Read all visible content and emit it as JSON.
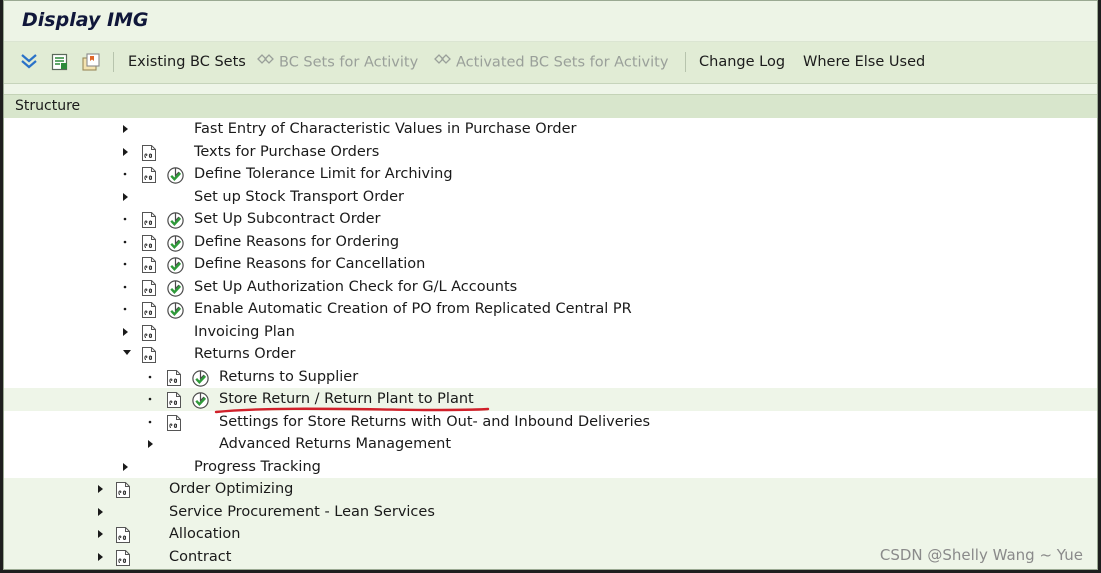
{
  "window_title": "Display IMG",
  "toolbar": {
    "existing_bc_sets": "Existing BC Sets",
    "bc_sets_for_activity": "BC Sets for Activity",
    "activated_bc_sets_for_activity": "Activated BC Sets for Activity",
    "change_log": "Change Log",
    "where_else_used": "Where Else Used"
  },
  "structure_header": "Structure",
  "tree": [
    {
      "label": "Fast Entry of Characteristic Values in Purchase Order",
      "level": 2,
      "expander": "collapsed",
      "doc": false,
      "activity": false,
      "band": "white"
    },
    {
      "label": "Texts for Purchase Orders",
      "level": 2,
      "expander": "collapsed",
      "doc": true,
      "activity": false,
      "band": "white"
    },
    {
      "label": "Define Tolerance Limit for Archiving",
      "level": 2,
      "expander": "leaf",
      "doc": true,
      "activity": true,
      "band": "white"
    },
    {
      "label": "Set up Stock Transport Order",
      "level": 2,
      "expander": "collapsed",
      "doc": false,
      "activity": false,
      "band": "white"
    },
    {
      "label": "Set Up Subcontract Order",
      "level": 2,
      "expander": "leaf",
      "doc": true,
      "activity": true,
      "band": "white"
    },
    {
      "label": "Define Reasons for Ordering",
      "level": 2,
      "expander": "leaf",
      "doc": true,
      "activity": true,
      "band": "white"
    },
    {
      "label": "Define Reasons for Cancellation",
      "level": 2,
      "expander": "leaf",
      "doc": true,
      "activity": true,
      "band": "white"
    },
    {
      "label": "Set Up Authorization Check for G/L Accounts",
      "level": 2,
      "expander": "leaf",
      "doc": true,
      "activity": true,
      "band": "white"
    },
    {
      "label": "Enable Automatic Creation of PO from Replicated Central PR",
      "level": 2,
      "expander": "leaf",
      "doc": true,
      "activity": true,
      "band": "white"
    },
    {
      "label": "Invoicing Plan",
      "level": 2,
      "expander": "collapsed",
      "doc": true,
      "activity": false,
      "band": "white"
    },
    {
      "label": "Returns Order",
      "level": 2,
      "expander": "expanded",
      "doc": true,
      "activity": false,
      "band": "white"
    },
    {
      "label": "Returns to Supplier",
      "level": 3,
      "expander": "leaf",
      "doc": true,
      "activity": true,
      "band": "white"
    },
    {
      "label": "Store Return / Return Plant to Plant",
      "level": 3,
      "expander": "leaf",
      "doc": true,
      "activity": true,
      "band": "selected"
    },
    {
      "label": "Settings for Store Returns with Out- and Inbound Deliveries",
      "level": 3,
      "expander": "leaf",
      "doc": true,
      "activity": false,
      "band": "white"
    },
    {
      "label": "Advanced Returns Management",
      "level": 3,
      "expander": "collapsed",
      "doc": false,
      "activity": false,
      "band": "white"
    },
    {
      "label": "Progress Tracking",
      "level": 2,
      "expander": "collapsed",
      "doc": false,
      "activity": false,
      "band": "white"
    },
    {
      "label": "Order Optimizing",
      "level": 1,
      "expander": "collapsed",
      "doc": true,
      "activity": false,
      "band": "green"
    },
    {
      "label": "Service Procurement - Lean Services",
      "level": 1,
      "expander": "collapsed",
      "doc": false,
      "activity": false,
      "band": "green"
    },
    {
      "label": "Allocation",
      "level": 1,
      "expander": "collapsed",
      "doc": true,
      "activity": false,
      "band": "green"
    },
    {
      "label": "Contract",
      "level": 1,
      "expander": "collapsed",
      "doc": true,
      "activity": false,
      "band": "green"
    }
  ],
  "annotation_color": "#d0202a",
  "selection_color": "#ffffc8",
  "watermark": "CSDN @Shelly Wang ~ Yue"
}
